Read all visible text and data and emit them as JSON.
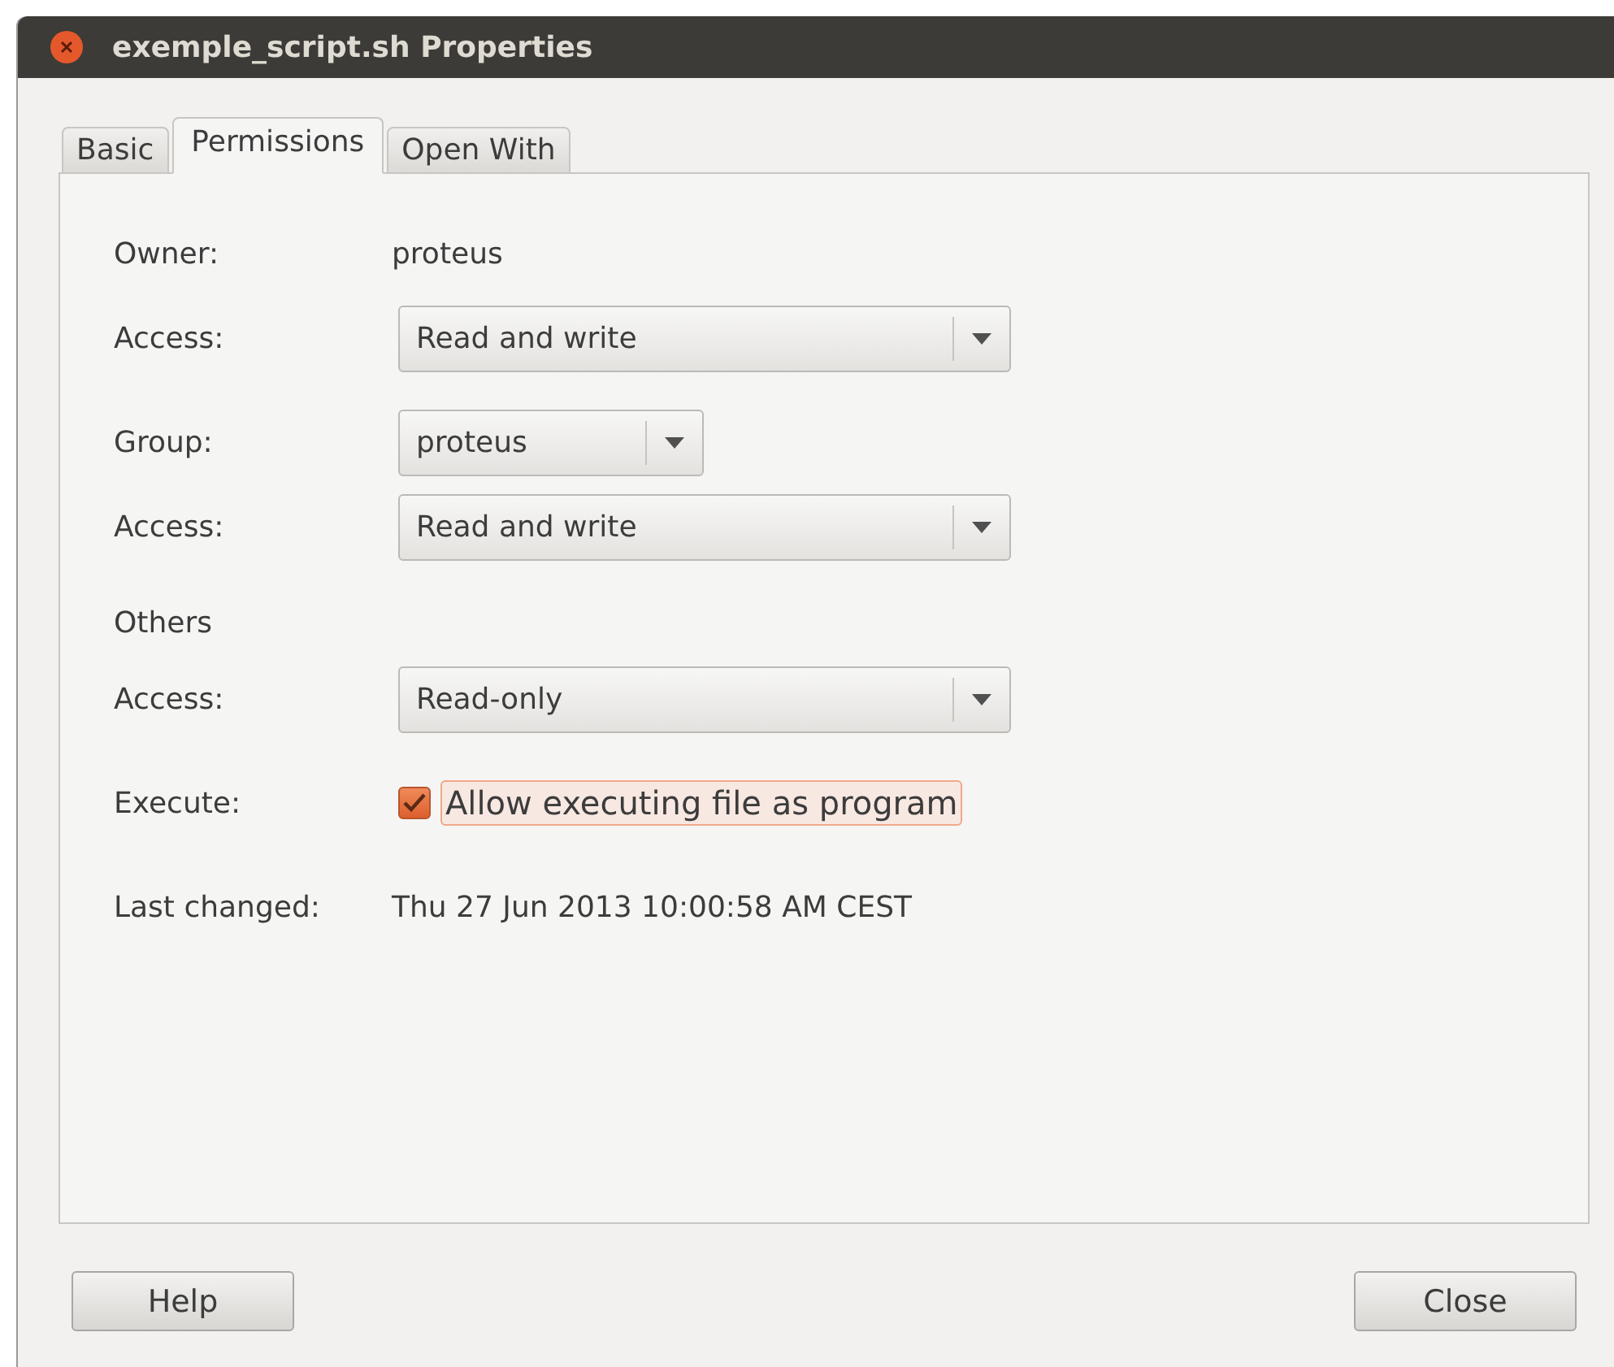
{
  "window": {
    "title": "exemple_script.sh Properties"
  },
  "tabs": [
    {
      "label": "Basic",
      "selected": false
    },
    {
      "label": "Permissions",
      "selected": true
    },
    {
      "label": "Open With",
      "selected": false
    }
  ],
  "sections": [
    {
      "rows": [
        {
          "kind": "value",
          "label": "Owner:",
          "value": "proteus"
        },
        {
          "kind": "dropdown",
          "label": "Access:",
          "value": "Read and write"
        }
      ]
    },
    {
      "rows": [
        {
          "kind": "short-dropdown",
          "label": "Group:",
          "value": "proteus"
        },
        {
          "kind": "dropdown",
          "label": "Access:",
          "value": "Read and write"
        }
      ]
    },
    {
      "rows": [
        {
          "kind": "heading",
          "label": "Others"
        },
        {
          "kind": "dropdown",
          "label": "Access:",
          "value": "Read-only"
        }
      ]
    },
    {
      "rows": [
        {
          "kind": "checkbox",
          "label": "Execute:",
          "value": "Allow executing file as program",
          "checked": true
        }
      ]
    },
    {
      "rows": [
        {
          "kind": "value",
          "label": "Last changed:",
          "value": "Thu 27 Jun 2013 10:00:58 AM CEST"
        }
      ]
    }
  ],
  "buttons": [
    "Help",
    "Close"
  ]
}
